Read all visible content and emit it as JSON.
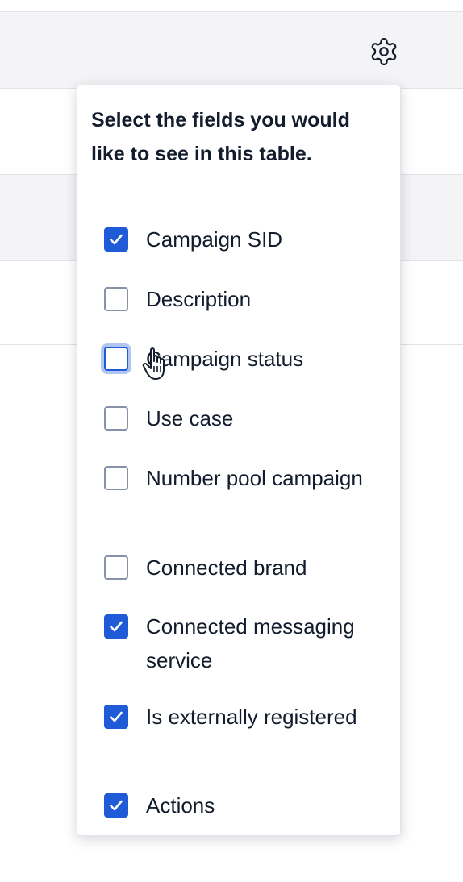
{
  "toolbar": {
    "settings_icon": "gear-icon"
  },
  "colors": {
    "accent": "#1f5bd6",
    "text": "#121c2d",
    "border": "#8891aa",
    "panel_bg": "#f4f4f6"
  },
  "popover": {
    "heading": "Select the fields you would like to see in this table.",
    "fields": [
      {
        "label": "Campaign SID",
        "checked": true
      },
      {
        "label": "Description",
        "checked": false
      },
      {
        "label": "Campaign status",
        "checked": false,
        "focused": true
      },
      {
        "label": "Use case",
        "checked": false
      },
      {
        "label": "Number pool campaign",
        "checked": false
      },
      {
        "label": "Connected brand",
        "checked": false
      },
      {
        "label": "Connected messaging service",
        "checked": true
      },
      {
        "label": "Is externally registered",
        "checked": true
      },
      {
        "label": "Actions",
        "checked": true
      }
    ]
  }
}
